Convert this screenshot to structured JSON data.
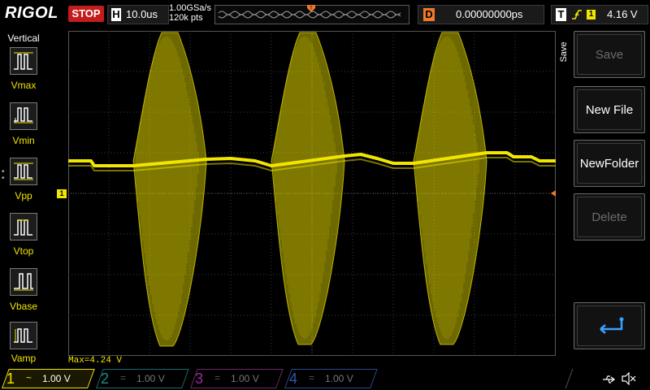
{
  "topbar": {
    "logo": "RIGOL",
    "run_state": "STOP",
    "horizontal_label": "H",
    "timebase": "10.0us",
    "sample_rate": "1.00GSa/s",
    "memory_depth": "120k pts",
    "delay_label": "D",
    "delay_value": "0.00000000ps",
    "trigger_label": "T",
    "trigger_channel": "1",
    "trigger_level": "4.16 V",
    "trigger_slope_icon": "rising-edge-icon",
    "trigger_position_marker_icon": "trigger-position-icon"
  },
  "left_panel": {
    "title": "Vertical",
    "items": [
      {
        "label": "Vmax",
        "icon": "vmax-icon"
      },
      {
        "label": "Vmin",
        "icon": "vmin-icon"
      },
      {
        "label": "Vpp",
        "icon": "vpp-icon"
      },
      {
        "label": "Vtop",
        "icon": "vtop-icon"
      },
      {
        "label": "Vbase",
        "icon": "vbase-icon"
      },
      {
        "label": "Vamp",
        "icon": "vamp-icon"
      }
    ]
  },
  "screen": {
    "ch1_marker": "1",
    "measurement": "Max=4.24 V",
    "trace_color": "#f2e600",
    "grid_color": "#3c3c3c"
  },
  "right_menu": {
    "tab_label": "Save",
    "buttons": [
      {
        "label": "Save",
        "enabled": false
      },
      {
        "label": "New File",
        "enabled": true
      },
      {
        "label": "NewFolder",
        "enabled": true
      },
      {
        "label": "Delete",
        "enabled": false
      }
    ],
    "enter_icon": "enter-return-icon"
  },
  "bottombar": {
    "channels": [
      {
        "num": "1",
        "coupling_icon": "ac-coupling-icon",
        "coupling": "~",
        "scale": "1.00 V",
        "color": "#f2e600",
        "active": true
      },
      {
        "num": "2",
        "coupling_icon": "dc-coupling-icon",
        "coupling": "=",
        "scale": "1.00 V",
        "color": "#1d8a8a",
        "active": false
      },
      {
        "num": "3",
        "coupling_icon": "dc-coupling-icon",
        "coupling": "=",
        "scale": "1.00 V",
        "color": "#9a2a9a",
        "active": false
      },
      {
        "num": "4",
        "coupling_icon": "dc-coupling-icon",
        "coupling": "=",
        "scale": "1.00 V",
        "color": "#2a5ab0",
        "active": false
      }
    ],
    "usb_icon": "usb-icon",
    "speaker_icon": "speaker-muted-icon"
  }
}
